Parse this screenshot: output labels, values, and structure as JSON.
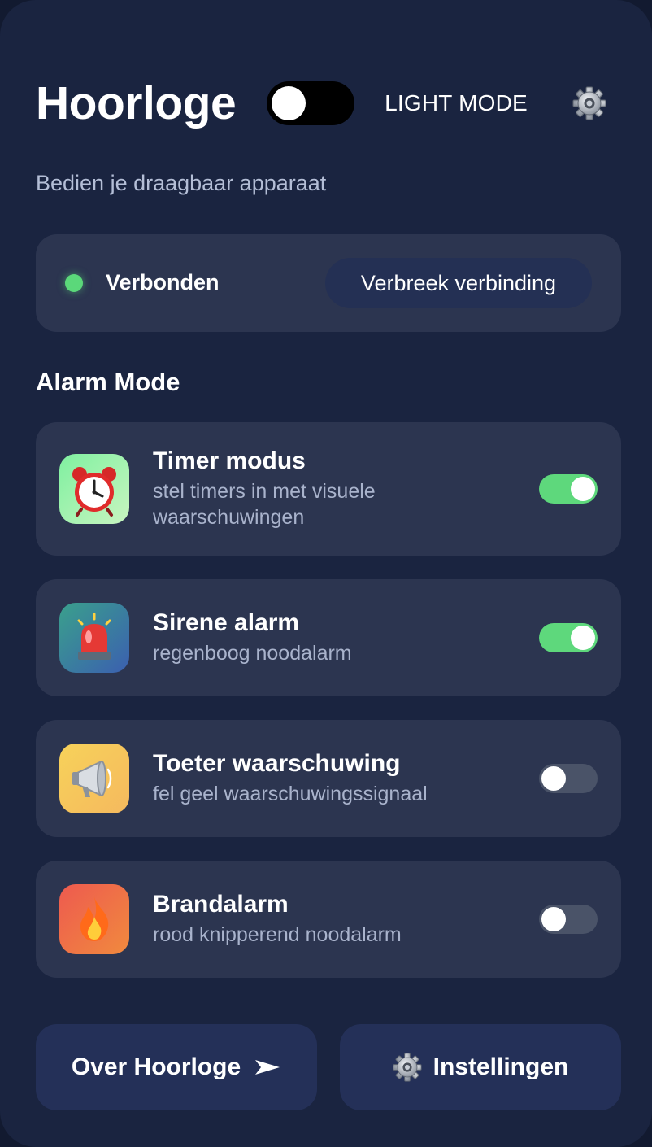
{
  "header": {
    "title": "Hoorloge",
    "mode_label": "LIGHT MODE",
    "theme_toggle_on": false,
    "settings_icon": "gear-icon"
  },
  "subtitle": "Bedien je draagbaar apparaat",
  "connection": {
    "status": "Verbonden",
    "status_color": "#5bd87a",
    "disconnect_label": "Verbreek verbinding"
  },
  "alarm_section": {
    "title": "Alarm Mode",
    "items": [
      {
        "name": "Timer modus",
        "description": "stel timers in met visuele waarschuwingen",
        "icon": "alarm-clock-icon",
        "enabled": true
      },
      {
        "name": "Sirene alarm",
        "description": "regenboog noodalarm",
        "icon": "siren-icon",
        "enabled": true
      },
      {
        "name": "Toeter waarschuwing",
        "description": "fel geel waarschuwingssignaal",
        "icon": "megaphone-icon",
        "enabled": false
      },
      {
        "name": "Brandalarm",
        "description": "rood knipperend noodalarm",
        "icon": "fire-icon",
        "enabled": false
      }
    ]
  },
  "footer": {
    "about_label": "Over Hoorloge",
    "about_icon": "arrow-right-icon",
    "settings_label": "Instellingen",
    "settings_icon": "gear-icon"
  },
  "colors": {
    "background": "#1a2440",
    "card": "#2c3550",
    "toggle_on": "#5ed87c",
    "toggle_off": "#4a5368",
    "button": "#243058"
  }
}
